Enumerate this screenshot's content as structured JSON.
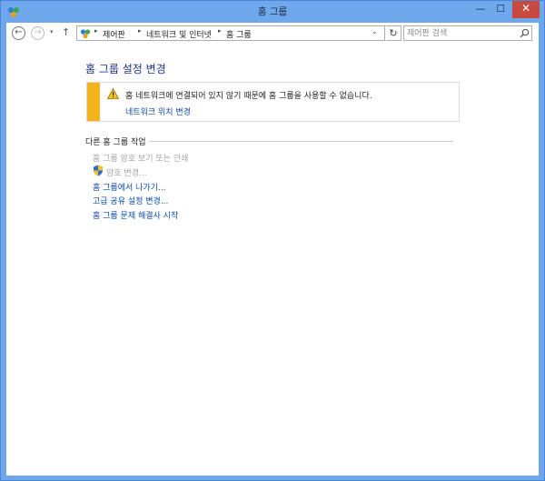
{
  "window": {
    "title": "홈 그룹",
    "controls": {
      "minimize": "—",
      "maximize": "☐",
      "close": "✕"
    }
  },
  "navigation": {
    "back_glyph": "←",
    "forward_glyph": "→",
    "recent_glyph": "▾",
    "up_glyph": "↑",
    "breadcrumbs": [
      "제어판",
      "네트워크 및 인터넷",
      "홈 그룹"
    ],
    "separator": "▸",
    "dropdown_glyph": "⌄",
    "refresh_glyph": "↻",
    "search_placeholder": "제어판 검색"
  },
  "main": {
    "heading": "홈 그룹 설정 변경",
    "alert": {
      "message": "홈 네트워크에 연결되어 있지 않기 때문에 홈 그룹을 사용할 수 없습니다.",
      "link": "네트워크 위치 변경",
      "accent_color": "#f3b31a"
    },
    "other_tasks": {
      "title": "다른 홈 그룹 작업",
      "items": [
        {
          "label": "홈 그룹 암호 보기 또는 인쇄",
          "enabled": false
        },
        {
          "label": "암호 변경...",
          "enabled": false,
          "icon": "shield-icon"
        },
        {
          "label": "홈 그룹에서 나가기...",
          "enabled": true
        },
        {
          "label": "고급 공유 설정 변경...",
          "enabled": true
        },
        {
          "label": "홈 그룹 문제 해결사 시작",
          "enabled": true
        }
      ]
    }
  },
  "colors": {
    "frame": "#6ea7ec",
    "link": "#0e4da5",
    "heading": "#1e3287",
    "close_button": "#c74a40"
  }
}
